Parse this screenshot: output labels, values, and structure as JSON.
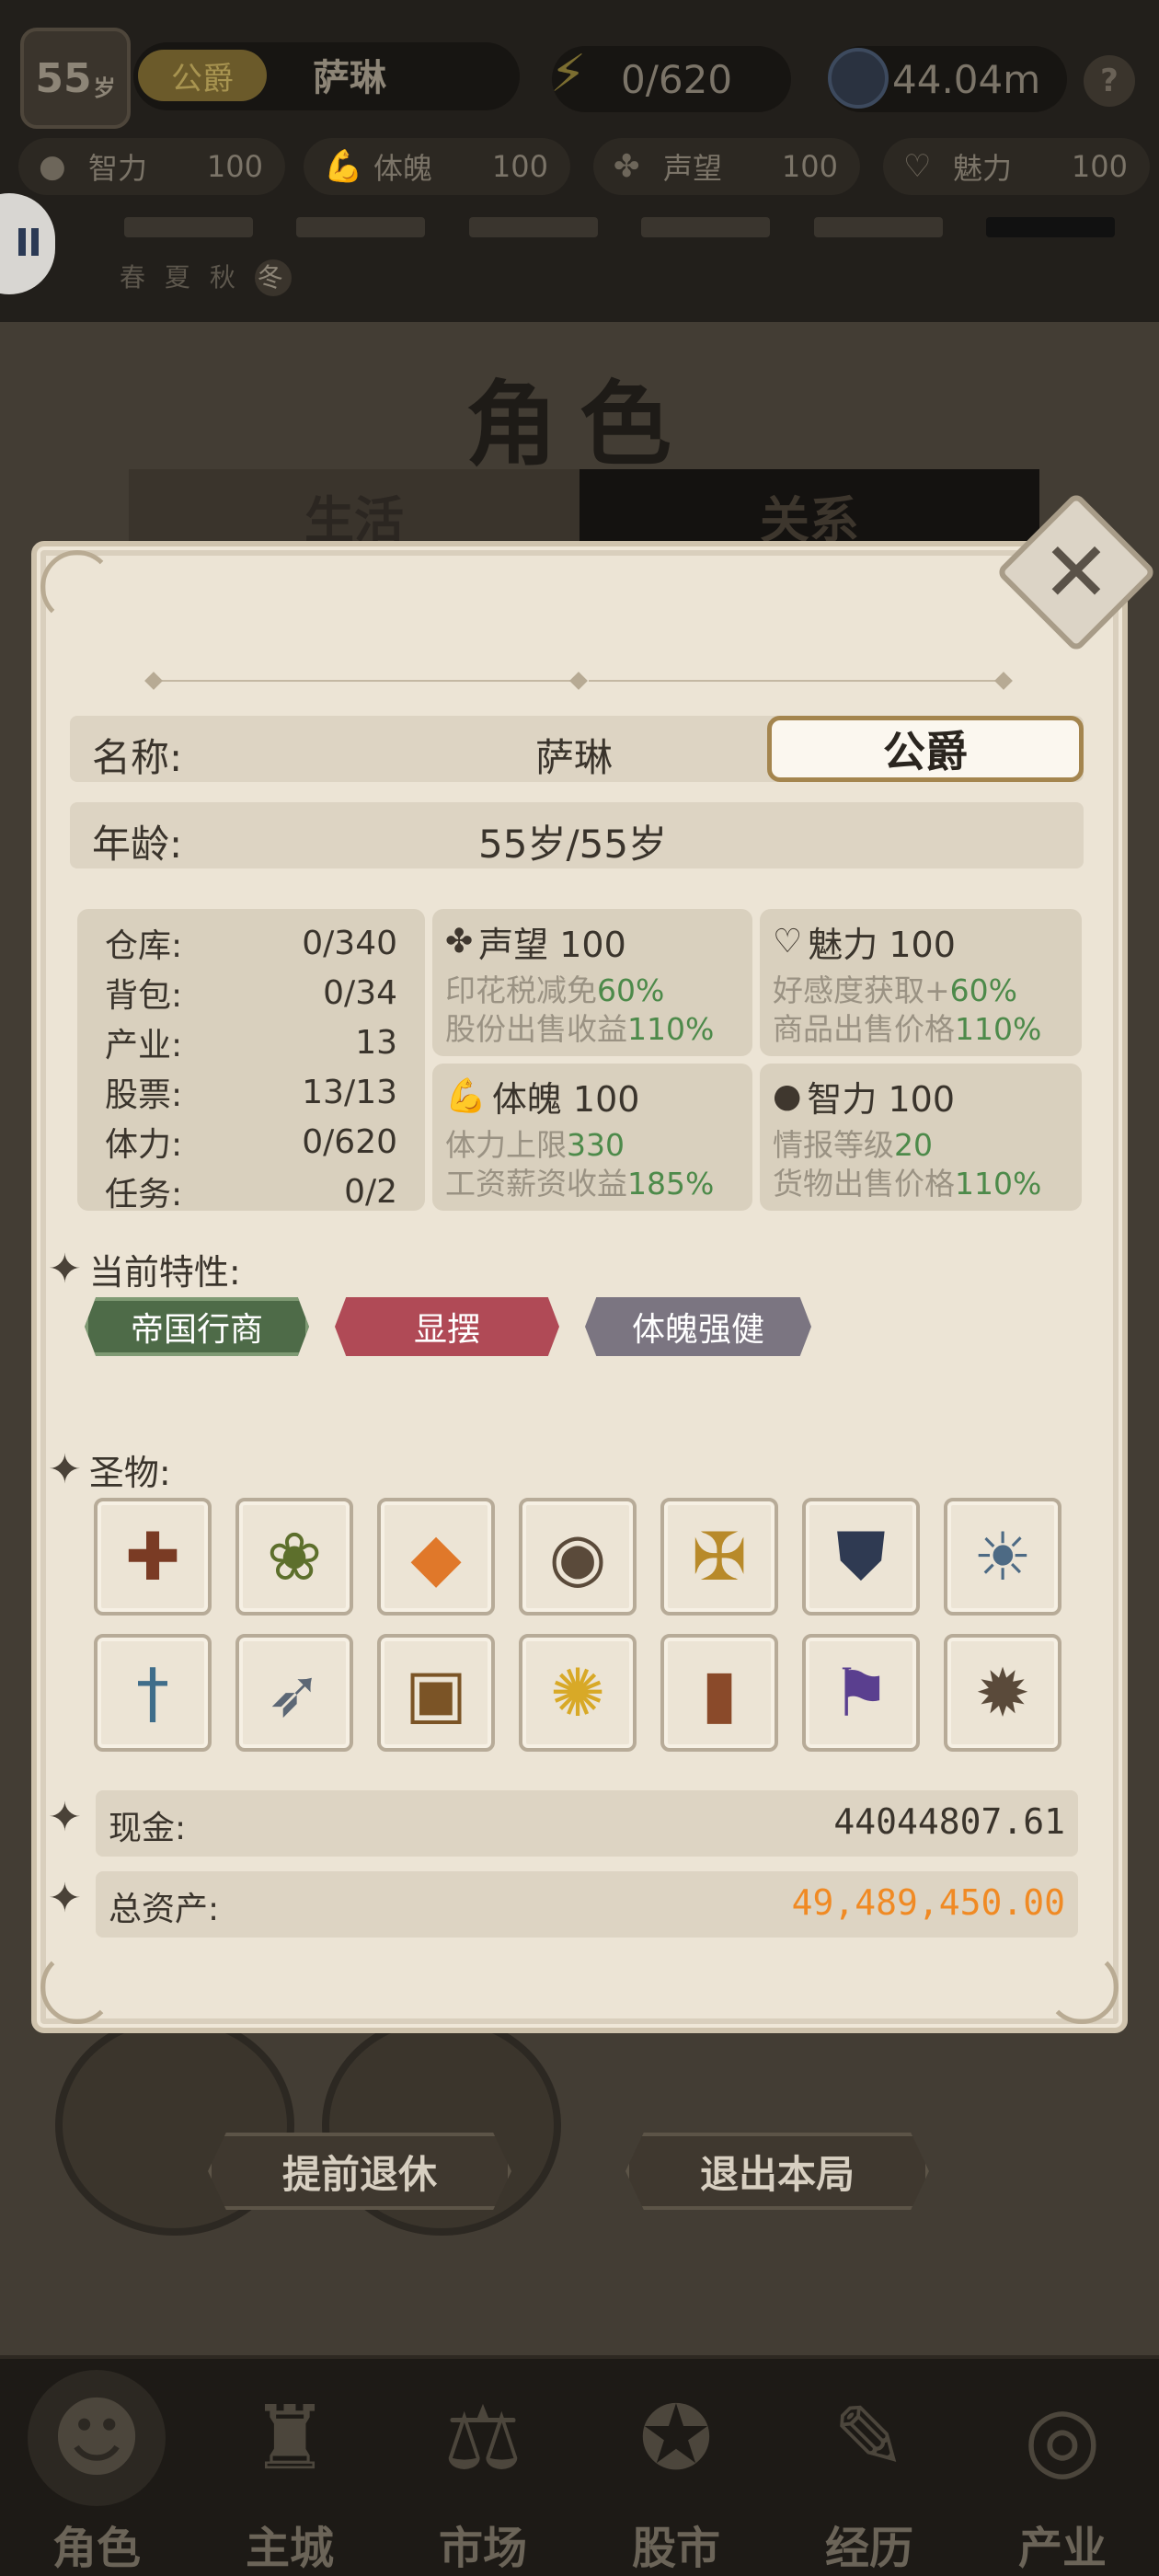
{
  "header": {
    "age": "55",
    "age_unit": "岁",
    "rank": "公爵",
    "name": "萨琳",
    "energy": "0/620",
    "money": "44.04m",
    "help": "?"
  },
  "stats": [
    {
      "label": "智力",
      "value": "100",
      "icon": "brain-icon"
    },
    {
      "label": "体魄",
      "value": "100",
      "icon": "muscle-icon"
    },
    {
      "label": "声望",
      "value": "100",
      "icon": "laurel-icon"
    },
    {
      "label": "魅力",
      "value": "100",
      "icon": "heart-icon"
    }
  ],
  "seasons": {
    "spring": "春",
    "summer": "夏",
    "autumn": "秋",
    "winter": "冬",
    "current": "冬"
  },
  "page": {
    "title": "角色",
    "tabs": [
      "生活",
      "关系"
    ]
  },
  "modal": {
    "name_label": "名称:",
    "name_value": "萨琳",
    "title_badge": "公爵",
    "age_label": "年龄:",
    "age_value": "55岁/55岁",
    "inventory": [
      {
        "label": "仓库:",
        "value": "0/340"
      },
      {
        "label": "背包:",
        "value": "0/34"
      },
      {
        "label": "产业:",
        "value": "13"
      },
      {
        "label": "股票:",
        "value": "13/13"
      },
      {
        "label": "体力:",
        "value": "0/620"
      },
      {
        "label": "任务:",
        "value": "0/2"
      }
    ],
    "attributes": [
      {
        "title": "声望 100",
        "icon": "laurel-icon",
        "lines": [
          {
            "text": "印花税减免",
            "value": "60%"
          },
          {
            "text": "股份出售收益",
            "value": "110%"
          }
        ]
      },
      {
        "title": "魅力 100",
        "icon": "heart-icon",
        "lines": [
          {
            "text": "好感度获取+",
            "value": "60%"
          },
          {
            "text": "商品出售价格",
            "value": "110%"
          }
        ]
      },
      {
        "title": "体魄 100",
        "icon": "muscle-icon",
        "lines": [
          {
            "text": "体力上限",
            "value": "330"
          },
          {
            "text": "工资薪资收益",
            "value": "185%"
          }
        ]
      },
      {
        "title": "智力 100",
        "icon": "brain-icon",
        "lines": [
          {
            "text": "情报等级",
            "value": "20"
          },
          {
            "text": "货物出售价格",
            "value": "110%"
          }
        ]
      }
    ],
    "traits_label": "当前特性:",
    "traits": [
      {
        "label": "帝国行商",
        "color": "#4e6b48"
      },
      {
        "label": "显摆",
        "color": "#b04a56"
      },
      {
        "label": "体魄强健",
        "color": "#7b7581"
      }
    ],
    "relics_label": "圣物:",
    "relics": [
      "holy-book-icon",
      "herb-bundle-icon",
      "silk-cloth-icon",
      "pendant-icon",
      "medal-icon",
      "horned-shield-icon",
      "sun-helmet-icon",
      "dagger-icon",
      "spearhead-icon",
      "treasure-chest-icon",
      "glowing-book-icon",
      "leather-bracer-icon",
      "banner-icon",
      "spiked-gauntlet-icon"
    ],
    "cash_label": "现金:",
    "cash_value": "44044807.61",
    "assets_label": "总资产:",
    "assets_value": "49,489,450.00",
    "assets_color": "#f08a24"
  },
  "buttons": {
    "retire": "提前退休",
    "exit": "退出本局"
  },
  "nav": [
    {
      "label": "角色",
      "icon": "character-icon"
    },
    {
      "label": "主城",
      "icon": "castle-icon"
    },
    {
      "label": "市场",
      "icon": "scales-icon"
    },
    {
      "label": "股市",
      "icon": "stock-icon"
    },
    {
      "label": "经历",
      "icon": "scroll-icon"
    },
    {
      "label": "产业",
      "icon": "coins-icon"
    }
  ]
}
